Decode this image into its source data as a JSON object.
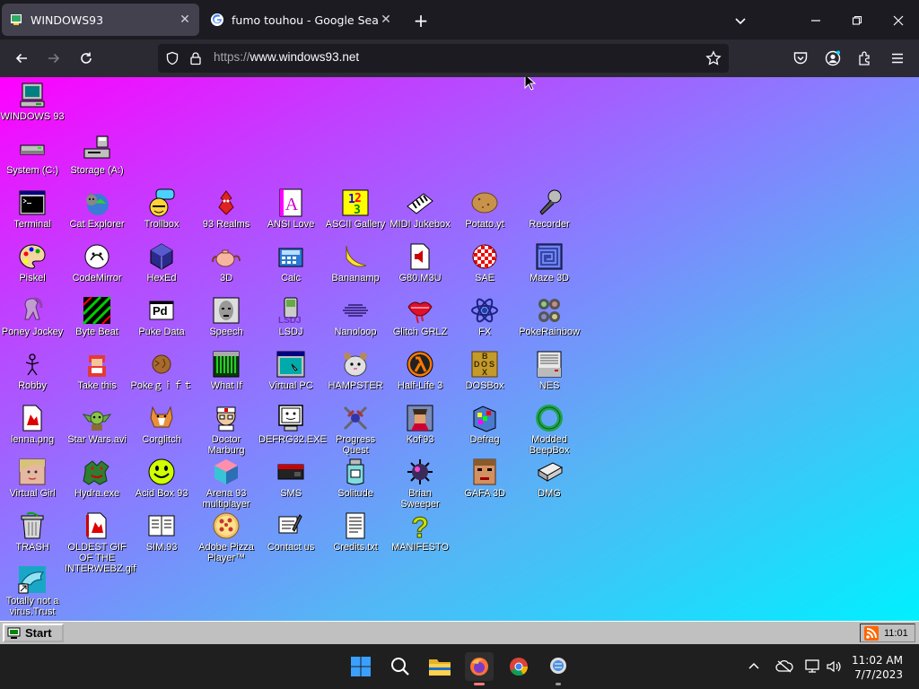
{
  "browser": {
    "tabs": [
      {
        "title": "WINDOWS93",
        "active": true
      },
      {
        "title": "fumo touhou - Google Search",
        "active": false
      }
    ],
    "url_protocol": "https://",
    "url_host": "www.windows93.net"
  },
  "desktop": {
    "icons": [
      {
        "label": "WINDOWS 93",
        "icon": "computer-icon"
      },
      {
        "label": "System (C:)",
        "icon": "drive-icon"
      },
      {
        "label": "Storage (A:)",
        "icon": "floppy-drive-icon"
      },
      {
        "label": "Terminal",
        "icon": "terminal-icon"
      },
      {
        "label": "Cat Explorer",
        "icon": "cat-globe-icon"
      },
      {
        "label": "Trollbox",
        "icon": "trollbox-icon"
      },
      {
        "label": "93 Realms",
        "icon": "realms-icon"
      },
      {
        "label": "ANSI Love",
        "icon": "ansi-icon"
      },
      {
        "label": "ASCII Gallery",
        "icon": "ascii-icon"
      },
      {
        "label": "MIDI Jukebox",
        "icon": "piano-icon"
      },
      {
        "label": "Potato.yt",
        "icon": "potato-icon"
      },
      {
        "label": "Recorder",
        "icon": "microphone-icon"
      },
      {
        "label": "Piskel",
        "icon": "palette-icon"
      },
      {
        "label": "CodeMirror",
        "icon": "codemirror-icon"
      },
      {
        "label": "HexEd",
        "icon": "hex-cube-icon"
      },
      {
        "label": "3D",
        "icon": "teapot-icon"
      },
      {
        "label": "Calc",
        "icon": "calculator-icon"
      },
      {
        "label": "Bananamp",
        "icon": "banana-icon"
      },
      {
        "label": "G80.M3U",
        "icon": "audio-file-icon"
      },
      {
        "label": "SAE",
        "icon": "ball-icon"
      },
      {
        "label": "Maze 3D",
        "icon": "maze-icon"
      },
      {
        "label": "Poney Jockey",
        "icon": "pony-icon"
      },
      {
        "label": "Byte Beat",
        "icon": "bytebeat-icon"
      },
      {
        "label": "Puke Data",
        "icon": "pd-icon"
      },
      {
        "label": "Speech",
        "icon": "speech-face-icon"
      },
      {
        "label": "LSDJ",
        "icon": "lsdj-icon"
      },
      {
        "label": "Nanoloop",
        "icon": "nanoloop-icon"
      },
      {
        "label": "Glitch GRLZ",
        "icon": "lips-icon"
      },
      {
        "label": "FX",
        "icon": "atom-icon"
      },
      {
        "label": "PokeRainbow",
        "icon": "pokerainbow-icon"
      },
      {
        "label": "Robby",
        "icon": "stickman-icon"
      },
      {
        "label": "Take this",
        "icon": "take-this-icon"
      },
      {
        "label": "Pokeｇｉｆｔ",
        "icon": "pokegift-icon"
      },
      {
        "label": "What If",
        "icon": "whatif-icon"
      },
      {
        "label": "Virtual PC",
        "icon": "virtual-pc-icon"
      },
      {
        "label": "HAMPSTER",
        "icon": "hamster-icon"
      },
      {
        "label": "Half-Life 3",
        "icon": "lambda-icon"
      },
      {
        "label": "DOSBox",
        "icon": "dosbox-icon"
      },
      {
        "label": "NES",
        "icon": "nes-icon"
      },
      {
        "label": "lenna.png",
        "icon": "image-file-icon"
      },
      {
        "label": "Star Wars.avi",
        "icon": "yoda-icon"
      },
      {
        "label": "Corglitch",
        "icon": "corgi-icon"
      },
      {
        "label": "Doctor Marburg",
        "icon": "doctor-icon"
      },
      {
        "label": "DEFRG32.EXE",
        "icon": "defrag-monitor-icon"
      },
      {
        "label": "Progress Quest",
        "icon": "swords-icon"
      },
      {
        "label": "Kof'93",
        "icon": "fighter-icon"
      },
      {
        "label": "Defrag",
        "icon": "defrag-icon"
      },
      {
        "label": "Modded BeepBox",
        "icon": "ring-icon"
      },
      {
        "label": "Virtual Girl",
        "icon": "virtual-girl-icon"
      },
      {
        "label": "Hydra.exe",
        "icon": "hydra-icon"
      },
      {
        "label": "Acid Box 93",
        "icon": "smiley-icon"
      },
      {
        "label": "Arena 93 multiplayer",
        "icon": "cube-icon"
      },
      {
        "label": "SMS",
        "icon": "sms-icon"
      },
      {
        "label": "Solitude",
        "icon": "solitude-icon"
      },
      {
        "label": "Brian Sweeper",
        "icon": "mine-icon"
      },
      {
        "label": "GAFA 3D",
        "icon": "doomguy-icon"
      },
      {
        "label": "DMG",
        "icon": "dmg-icon"
      },
      {
        "label": "TRASH",
        "icon": "trash-icon"
      },
      {
        "label": "OLDEST GIF OF THE INTERWEBZ.gif",
        "icon": "gif-file-icon"
      },
      {
        "label": "SIM.93",
        "icon": "sim-icon"
      },
      {
        "label": "Adobe Pizza Player™",
        "icon": "pizza-icon"
      },
      {
        "label": "Contact us",
        "icon": "contact-icon"
      },
      {
        "label": "Credits.txt",
        "icon": "text-file-icon"
      },
      {
        "label": "MANIFESTO",
        "icon": "question-icon"
      },
      {
        "label": "Totally not a virus.Trust",
        "icon": "dolphin-icon"
      }
    ]
  },
  "w93_taskbar": {
    "start_label": "Start",
    "tray_time": "11:01"
  },
  "win_taskbar": {
    "time": "11:02 AM",
    "date": "7/7/2023"
  }
}
